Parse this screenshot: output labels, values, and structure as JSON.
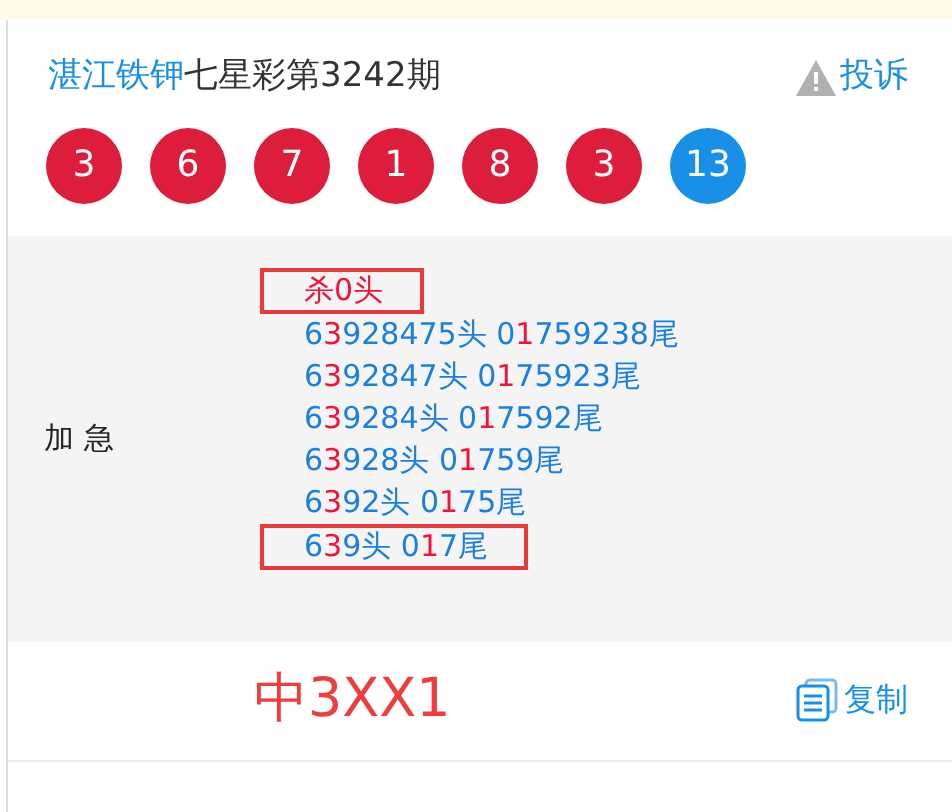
{
  "title": {
    "source": "湛江铁钾",
    "text": "七星彩第3242期"
  },
  "report": {
    "label": "投诉"
  },
  "balls": [
    {
      "number": "3",
      "color": "#dc1e3c"
    },
    {
      "number": "6",
      "color": "#dc1e3c"
    },
    {
      "number": "7",
      "color": "#dc1e3c"
    },
    {
      "number": "1",
      "color": "#dc1e3c"
    },
    {
      "number": "8",
      "color": "#dc1e3c"
    },
    {
      "number": "3",
      "color": "#dc1e3c"
    },
    {
      "number": "13",
      "color": "#1890e8"
    }
  ],
  "prediction": {
    "label": "加 急",
    "lines": [
      {
        "boxed": true,
        "parts": [
          {
            "text": "杀0头",
            "red": true
          }
        ]
      },
      {
        "boxed": false,
        "parts": [
          {
            "text": "6",
            "red": false
          },
          {
            "text": "3",
            "red": true
          },
          {
            "text": "928475头 0",
            "red": false
          },
          {
            "text": "1",
            "red": true
          },
          {
            "text": "759238尾",
            "red": false
          }
        ]
      },
      {
        "boxed": false,
        "parts": [
          {
            "text": "6",
            "red": false
          },
          {
            "text": "3",
            "red": true
          },
          {
            "text": "92847头 0",
            "red": false
          },
          {
            "text": "1",
            "red": true
          },
          {
            "text": "75923尾",
            "red": false
          }
        ]
      },
      {
        "boxed": false,
        "parts": [
          {
            "text": "6",
            "red": false
          },
          {
            "text": "3",
            "red": true
          },
          {
            "text": "9284头 0",
            "red": false
          },
          {
            "text": "1",
            "red": true
          },
          {
            "text": "7592尾",
            "red": false
          }
        ]
      },
      {
        "boxed": false,
        "parts": [
          {
            "text": "6",
            "red": false
          },
          {
            "text": "3",
            "red": true
          },
          {
            "text": "928头 0",
            "red": false
          },
          {
            "text": "1",
            "red": true
          },
          {
            "text": "759尾",
            "red": false
          }
        ]
      },
      {
        "boxed": false,
        "parts": [
          {
            "text": "6",
            "red": false
          },
          {
            "text": "3",
            "red": true
          },
          {
            "text": "92头 0",
            "red": false
          },
          {
            "text": "1",
            "red": true
          },
          {
            "text": "75尾",
            "red": false
          }
        ]
      },
      {
        "boxed": true,
        "parts": [
          {
            "text": "6",
            "red": false
          },
          {
            "text": "3",
            "red": true
          },
          {
            "text": "9头 0",
            "red": false
          },
          {
            "text": "1",
            "red": true
          },
          {
            "text": "7尾",
            "red": false
          }
        ]
      }
    ]
  },
  "result": {
    "text": "中3XX1"
  },
  "copy": {
    "label": "复制"
  }
}
